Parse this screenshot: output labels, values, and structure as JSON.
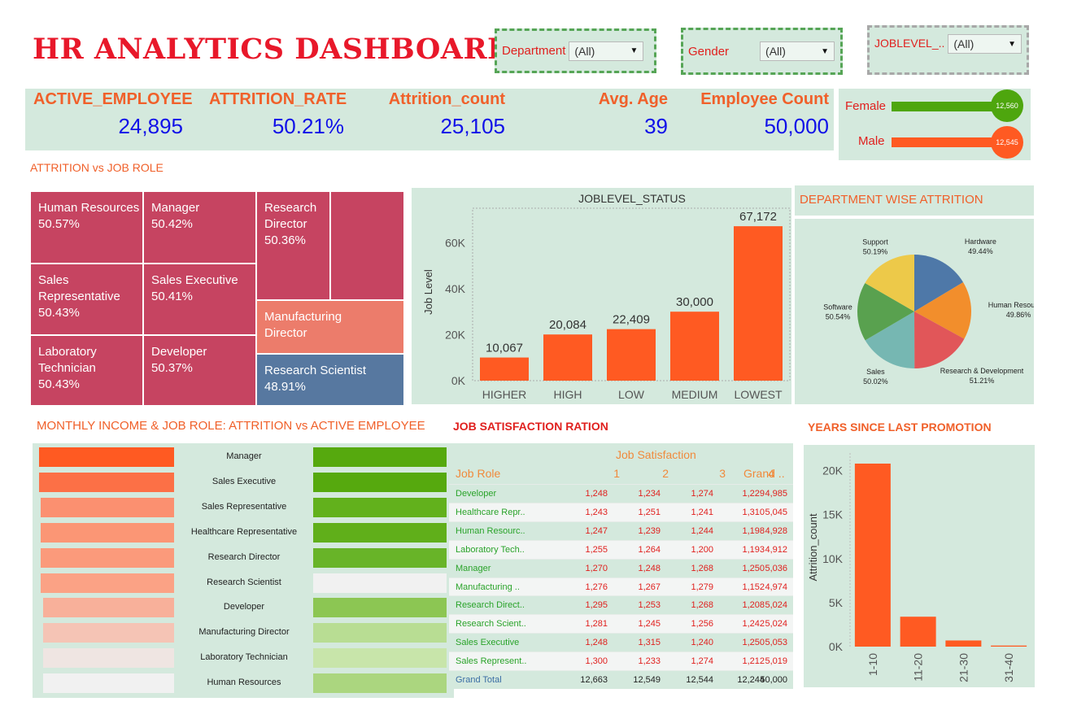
{
  "title": "HR ANALYTICS DASHBOARD",
  "filters": [
    {
      "label": "Department",
      "value": "(All)"
    },
    {
      "label": "Gender",
      "value": "(All)"
    },
    {
      "label": "JOBLEVEL_..",
      "value": "(All)"
    }
  ],
  "kpis": [
    {
      "label": "ACTIVE_EMPLOYEE",
      "value": "24,895"
    },
    {
      "label": "ATTRITION_RATE",
      "value": "50.21%"
    },
    {
      "label": "Attrition_count",
      "value": "25,105"
    },
    {
      "label": "Avg. Age",
      "value": "39"
    },
    {
      "label": "Employee Count",
      "value": "50,000"
    }
  ],
  "gender": [
    {
      "label": "Female",
      "value": "12,560",
      "color": "#4ea60e"
    },
    {
      "label": "Male",
      "value": "12,545",
      "color": "#ff5a22"
    }
  ],
  "sections": {
    "treemap": "ATTRITION vs JOB ROLE",
    "dept": "DEPARTMENT WISE ATTRITION",
    "income": "MONTHLY INCOME & JOB ROLE: ATTRITION vs ACTIVE EMPLOYEE",
    "jobsat": "JOB SATISFACTION RATION",
    "promotion": "YEARS SINCE LAST PROMOTION"
  },
  "treemap": [
    {
      "name": "Human Resources",
      "value": "50.57%",
      "color": "#c64461"
    },
    {
      "name": "Manager",
      "value": "50.42%",
      "color": "#c64461"
    },
    {
      "name": "Research Director",
      "value": "50.36%",
      "color": "#c64461"
    },
    {
      "name": "Sales Representative",
      "value": "50.43%",
      "color": "#c64461"
    },
    {
      "name": "Sales Executive",
      "value": "50.41%",
      "color": "#c64461"
    },
    {
      "name": "Manufacturing Director",
      "value": "",
      "color": "#ec7c6b"
    },
    {
      "name": "Laboratory Technician",
      "value": "50.43%",
      "color": "#c64461"
    },
    {
      "name": "Developer",
      "value": "50.37%",
      "color": "#c64461"
    },
    {
      "name": "Research Scientist",
      "value": "48.91%",
      "color": "#5778a0"
    }
  ],
  "chart_data": [
    {
      "type": "bar",
      "title": "JOBLEVEL_STATUS",
      "ylabel": "Job Level",
      "categories": [
        "HIGHER",
        "HIGH",
        "LOW",
        "MEDIUM",
        "LOWEST"
      ],
      "values": [
        10067,
        20084,
        22409,
        30000,
        67172
      ],
      "labels": [
        "10,067",
        "20,084",
        "22,409",
        "30,000",
        "67,172"
      ],
      "yticks": [
        "0K",
        "20K",
        "40K",
        "60K"
      ],
      "ylim": [
        0,
        75000
      ],
      "color": "#ff5a22"
    },
    {
      "type": "pie",
      "slices": [
        {
          "name": "Hardware",
          "value": 49.44,
          "label": "49.44%",
          "color": "#4e78a8"
        },
        {
          "name": "Human Resources",
          "value": 49.86,
          "label": "49.86%",
          "color": "#f28e2c"
        },
        {
          "name": "Research & Development",
          "value": 51.21,
          "label": "51.21%",
          "color": "#e15659"
        },
        {
          "name": "Sales",
          "value": 50.02,
          "label": "50.02%",
          "color": "#76b7b2"
        },
        {
          "name": "Software",
          "value": 50.54,
          "label": "50.54%",
          "color": "#59a14f"
        },
        {
          "name": "Support",
          "value": 50.19,
          "label": "50.19%",
          "color": "#edc949"
        }
      ]
    },
    {
      "type": "bar",
      "ylabel": "Attrition_count",
      "categories": [
        "1-10",
        "11-20",
        "21-30",
        "31-40"
      ],
      "values": [
        20800,
        3400,
        700,
        120
      ],
      "yticks": [
        "0K",
        "5K",
        "10K",
        "15K",
        "20K"
      ],
      "ylim": [
        0,
        22000
      ],
      "color": "#ff5a22"
    }
  ],
  "income": {
    "roles": [
      "Manager",
      "Sales Executive",
      "Sales Representative",
      "Healthcare Representative",
      "Research Director",
      "Research Scientist",
      "Developer",
      "Manufacturing Director",
      "Laboratory Technician",
      "Human Resources"
    ],
    "left_colors": [
      "#ff5a22",
      "#fc7046",
      "#fb9070",
      "#fb9675",
      "#fb9a7b",
      "#fba285",
      "#f8b09a",
      "#f5c4b5",
      "#efe5e2",
      "#f1f1f1"
    ],
    "right_colors": [
      "#56a90e",
      "#56a90e",
      "#62b11c",
      "#60af1a",
      "#68b428",
      "#f1f1f1",
      "#8cc653",
      "#b8dd93",
      "#c8e5aa",
      "#abd67f"
    ]
  },
  "jobsat": {
    "header_group": "Job Satisfaction",
    "columns": [
      "Job Role",
      "1",
      "2",
      "3",
      "4",
      "Grand .."
    ],
    "rows": [
      [
        "Developer",
        "1,248",
        "1,234",
        "1,274",
        "1,229",
        "4,985"
      ],
      [
        "Healthcare Repr..",
        "1,243",
        "1,251",
        "1,241",
        "1,310",
        "5,045"
      ],
      [
        "Human Resourc..",
        "1,247",
        "1,239",
        "1,244",
        "1,198",
        "4,928"
      ],
      [
        "Laboratory Tech..",
        "1,255",
        "1,264",
        "1,200",
        "1,193",
        "4,912"
      ],
      [
        "Manager",
        "1,270",
        "1,248",
        "1,268",
        "1,250",
        "5,036"
      ],
      [
        "Manufacturing ..",
        "1,276",
        "1,267",
        "1,279",
        "1,152",
        "4,974"
      ],
      [
        "Research Direct..",
        "1,295",
        "1,253",
        "1,268",
        "1,208",
        "5,024"
      ],
      [
        "Research Scient..",
        "1,281",
        "1,245",
        "1,256",
        "1,242",
        "5,024"
      ],
      [
        "Sales Executive",
        "1,248",
        "1,315",
        "1,240",
        "1,250",
        "5,053"
      ],
      [
        "Sales Represent..",
        "1,300",
        "1,233",
        "1,274",
        "1,212",
        "5,019"
      ]
    ],
    "total": [
      "Grand Total",
      "12,663",
      "12,549",
      "12,544",
      "12,244",
      "50,000"
    ]
  }
}
